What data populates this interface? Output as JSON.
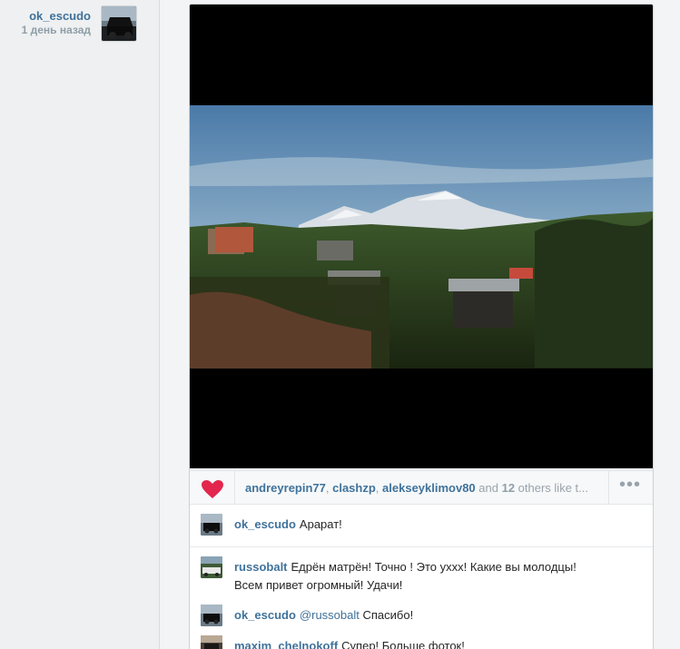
{
  "post": {
    "author": "ok_escudo",
    "time": "1 день назад"
  },
  "likes": {
    "users": [
      "andreyrepin77",
      "clashzp",
      "alekseyklimov80"
    ],
    "sep": ", ",
    "and_text": " and ",
    "others_count": "12",
    "others_text": " others like t..."
  },
  "comments": [
    {
      "user": "ok_escudo",
      "text": "Арарат!"
    },
    {
      "user": "russobalt",
      "text": "Едрён матрён! Точно ! Это ухxх! Какие вы молодцы!",
      "text2": "Всем привет огромный! Удачи!"
    },
    {
      "user": "ok_escudo",
      "mention": "@russobalt",
      "text": " Спасибо!"
    },
    {
      "user": "maxim_chelnokoff",
      "text": "Супер! Больше фоток!"
    }
  ],
  "icons": {
    "like": "heart-icon",
    "more": "more-options-icon"
  },
  "colors": {
    "link": "#3f729b",
    "heart": "#e2264d",
    "muted": "#9aa3aa"
  }
}
